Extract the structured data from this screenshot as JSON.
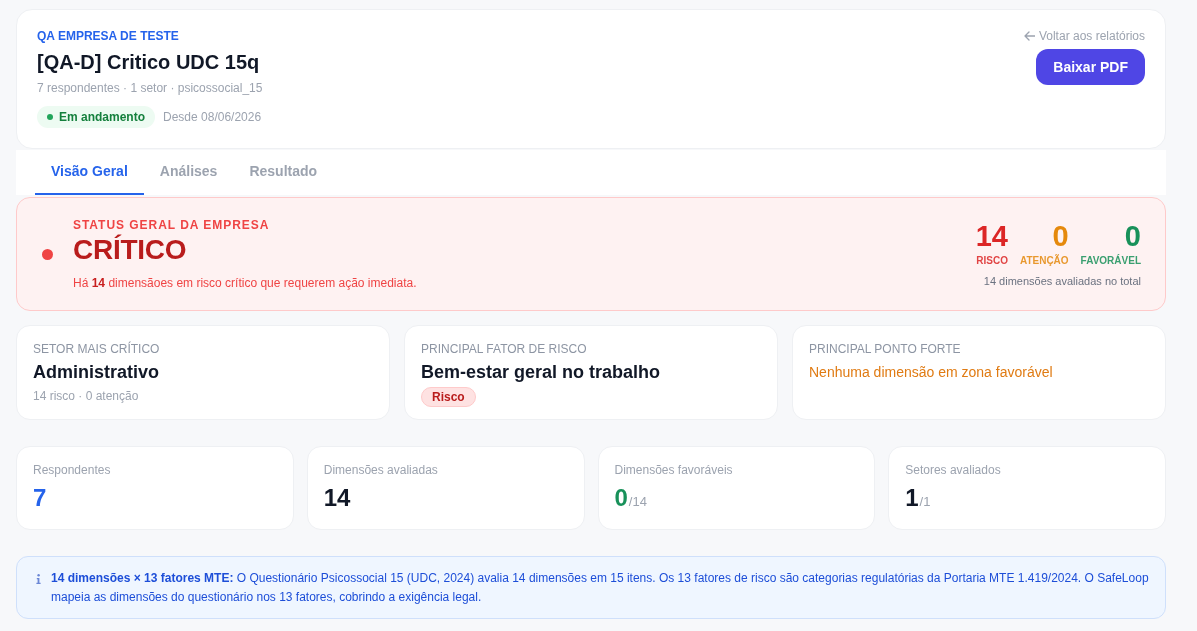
{
  "header": {
    "company": "QA EMPRESA DE TESTE",
    "title": "[QA-D] Critico UDC 15q",
    "meta": "7 respondentes · 1 setor · psicossocial_15",
    "status_badge": "Em andamento",
    "since": "Desde 08/06/2026",
    "back_link": "Voltar aos relatórios",
    "download_button": "Baixar PDF"
  },
  "tabs": [
    {
      "label": "Visão Geral",
      "selected": true
    },
    {
      "label": "Análises",
      "selected": false
    },
    {
      "label": "Resultado",
      "selected": false
    }
  ],
  "status": {
    "eyebrow": "STATUS GERAL DA EMPRESA",
    "title": "CRÍTICO",
    "message": "Há **14** dimensãoes em risco crítico que requerem ação imediata.",
    "counts": [
      {
        "value": "14",
        "label": "RISCO",
        "color": "#dc2626"
      },
      {
        "value": "0",
        "label": "ATENÇÃO",
        "color": "#e5890c"
      },
      {
        "value": "0",
        "label": "FAVORÁVEL",
        "color": "#18915a"
      }
    ],
    "total_note": "14 dimensões avaliadas no total"
  },
  "highlights": [
    {
      "label": "SETOR MAIS CRÍTICO",
      "value": "Administrativo",
      "note": "14 risco · 0 atenção"
    },
    {
      "label": "PRINCIPAL FATOR DE RISCO",
      "value": "Bem-estar geral no trabalho",
      "tag": "Risco"
    },
    {
      "label": "PRINCIPAL PONTO FORTE",
      "empty_message": "Nenhuma dimensão em zona favorável"
    }
  ],
  "stats": [
    {
      "label": "Respondentes",
      "value": "7",
      "color": "#2563eb"
    },
    {
      "label": "Dimensões avaliadas",
      "value": "14",
      "color": "#111827"
    },
    {
      "label": "Dimensões favoráveis",
      "value": "0",
      "total": "/14",
      "color": "#18915a"
    },
    {
      "label": "Setores avaliados",
      "value": "1",
      "total": "/1",
      "color": "#111827"
    }
  ],
  "info_note": "**14 dimensões × 13 fatores MTE:** O Questionário Psicossocial 15 (UDC, 2024) avalia 14 dimensões em 15 itens. Os 13 fatores de risco são categorias regulatórias da Portaria MTE 1.419/2024. O SafeLoop mapeia as dimensões do questionário nos 13 fatores, cobrindo a exigência legal."
}
